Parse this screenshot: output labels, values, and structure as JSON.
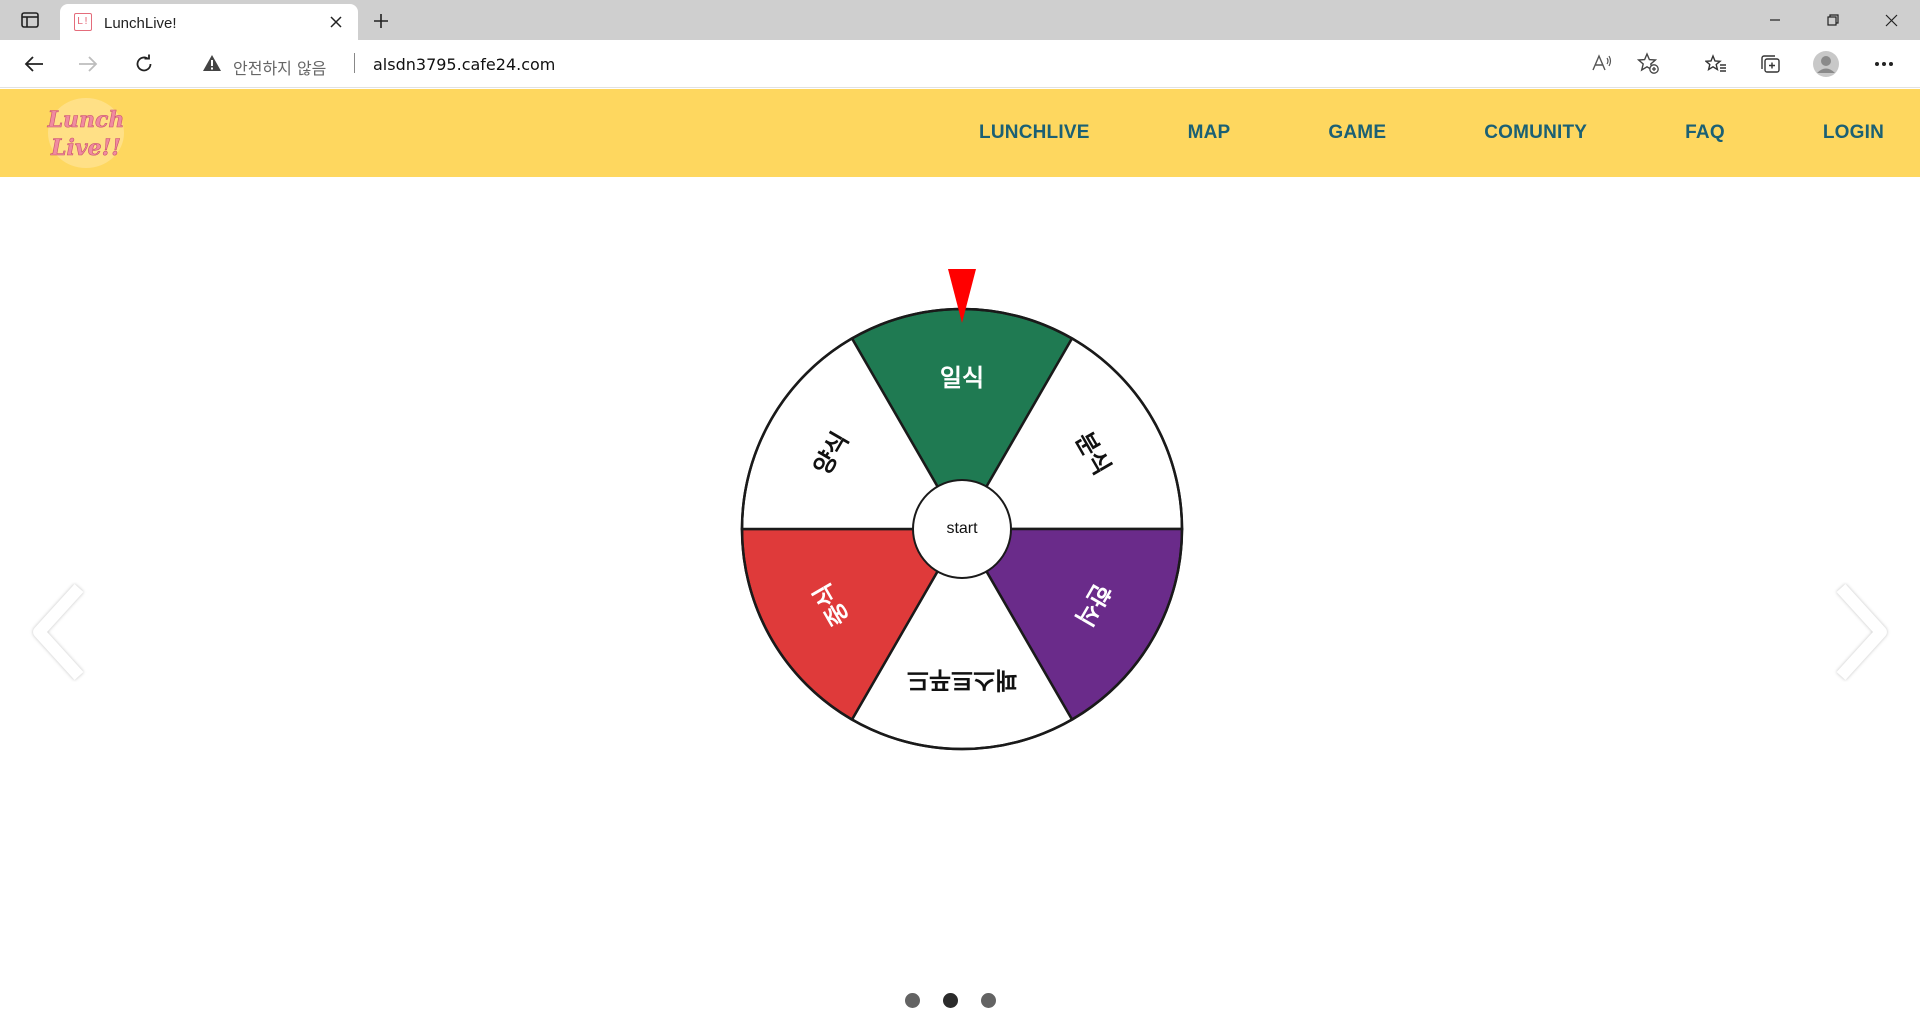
{
  "browser": {
    "tab_title": "LunchLive!",
    "favicon_text": "L!",
    "security_label": "안전하지 않음",
    "url": "alsdn3795.cafe24.com"
  },
  "header": {
    "logo_line1": "Lunch",
    "logo_line2": "Live!!",
    "nav": [
      {
        "label": "LUNCHLIVE"
      },
      {
        "label": "MAP"
      },
      {
        "label": "GAME"
      },
      {
        "label": "COMUNITY"
      },
      {
        "label": "FAQ"
      },
      {
        "label": "LOGIN"
      }
    ]
  },
  "wheel": {
    "start_label": "start",
    "segments": [
      {
        "label": "일식",
        "color": "#1f7a52",
        "text_color": "#ffffff"
      },
      {
        "label": "분식",
        "color": "#ffffff",
        "text_color": "#111111"
      },
      {
        "label": "한식",
        "color": "#6a2b8a",
        "text_color": "#ffffff"
      },
      {
        "label": "패스트푸드",
        "color": "#ffffff",
        "text_color": "#111111"
      },
      {
        "label": "중식",
        "color": "#df3a3a",
        "text_color": "#ffffff"
      },
      {
        "label": "양식",
        "color": "#ffffff",
        "text_color": "#111111"
      }
    ],
    "pointer_color": "#ff0000"
  },
  "carousel": {
    "slide_count": 3,
    "active_index": 1
  },
  "colors": {
    "header_bg": "#fed75f",
    "nav_text": "#1b6074"
  }
}
